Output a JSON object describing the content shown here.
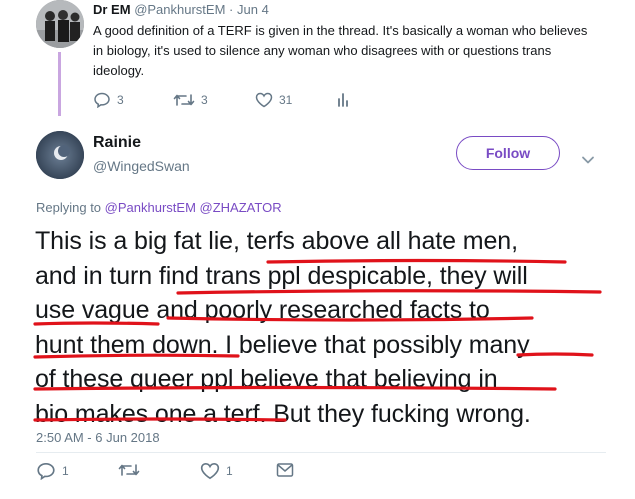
{
  "parent_tweet": {
    "author_name": "Dr EM",
    "author_handle": "@PankhurstEM",
    "separator": "·",
    "date": "Jun 4",
    "text": "A good definition of a TERF is given in the thread. It's basically a woman who believes in biology, it's used to silence any woman who disagrees with or questions trans ideology.",
    "reply_count": "3",
    "retweet_count": "3",
    "like_count": "31"
  },
  "main_tweet": {
    "author_name": "Rainie",
    "author_handle": "@WingedSwan",
    "follow_label": "Follow",
    "replying_to_label": "Replying to",
    "mentions": [
      "@PankhurstEM",
      "@ZHAZATOR"
    ],
    "text_lines": [
      "This is a big fat lie, terfs above all hate men,",
      "and in turn find trans ppl despicable, they will",
      "use vague and poorly researched facts to",
      "hunt them down. I believe that possibly many",
      "of these queer ppl believe that believing in",
      "bio makes one a terf. But they fucking wrong."
    ],
    "timestamp": "2:50 AM - 6 Jun 2018",
    "reply_count": "1",
    "retweet_count": "",
    "like_count": "1"
  },
  "colors": {
    "accent": "#794bc4",
    "thread_line": "#c9a6e0",
    "secondary_text": "#657786",
    "underline": "#e0121a"
  },
  "icons": [
    "reply-icon",
    "retweet-icon",
    "like-icon",
    "analytics-icon",
    "message-icon",
    "chevron-down-icon"
  ]
}
